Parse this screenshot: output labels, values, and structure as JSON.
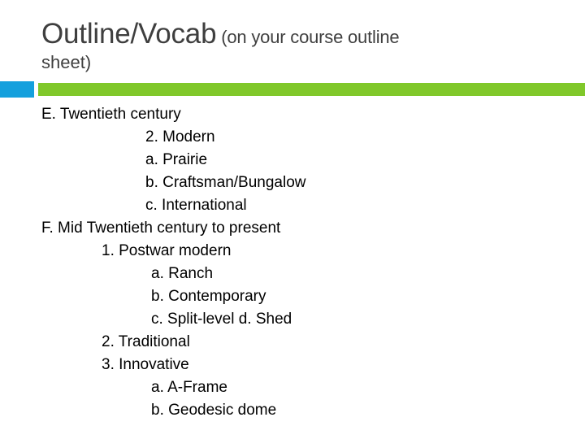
{
  "slide": {
    "background_color": "#FFFFFF",
    "title": {
      "main": "Outline/Vocab",
      "subtitle_part_1": " (on your course outline",
      "subtitle_part_2": "sheet)"
    },
    "accent": {
      "blue_color": "#14A0DD",
      "green_color": "#80C82A"
    },
    "outline": [
      {
        "text": "E. Twentieth century",
        "level": 0
      },
      {
        "text": "2. Modern",
        "level": 2
      },
      {
        "text": "a. Prairie",
        "level": 2
      },
      {
        "text": "b. Craftsman/Bungalow",
        "level": 2
      },
      {
        "text": "c. International",
        "level": 2
      },
      {
        "text": "F. Mid Twentieth century to present",
        "level": 0
      },
      {
        "text": "1. Postwar modern",
        "level": 1
      },
      {
        "text": "a. Ranch",
        "level": 3
      },
      {
        "text": "b. Contemporary",
        "level": 3
      },
      {
        "text": "c. Split-level d. Shed",
        "level": 3
      },
      {
        "text": "2. Traditional",
        "level": 1
      },
      {
        "text": "3. Innovative",
        "level": 1
      },
      {
        "text": "a. A-Frame",
        "level": 3
      },
      {
        "text": "b. Geodesic dome",
        "level": 3
      }
    ]
  }
}
